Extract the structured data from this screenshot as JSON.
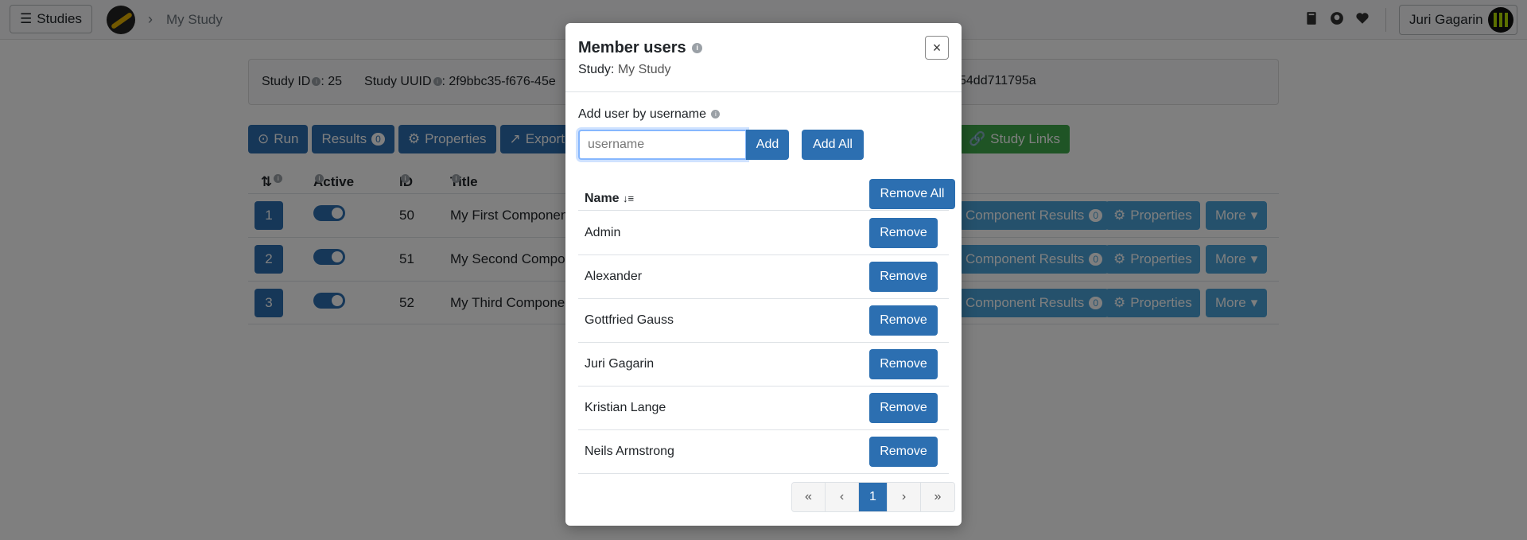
{
  "navbar": {
    "studies_label": "Studies",
    "breadcrumb": "My Study",
    "user_label": "Juri Gagarin"
  },
  "study_info": {
    "id_label": "Study ID",
    "id_value": ":  25",
    "uuid_label": "Study UUID",
    "uuid_value_visible": ":  2f9bbc35-f676-45e",
    "uuid_tail": "54dd711795a"
  },
  "toolbar": {
    "run": "Run",
    "results": "Results",
    "results_count": "0",
    "properties": "Properties",
    "export": "Export",
    "study_links": "Study Links"
  },
  "components_table": {
    "headers": {
      "position": "",
      "active": "Active",
      "id": "ID",
      "title": "Title"
    },
    "rows": [
      {
        "pos": "1",
        "id": "50",
        "title": "My First Component",
        "results": "Component Results",
        "count": "0",
        "props": "Properties",
        "more": "More"
      },
      {
        "pos": "2",
        "id": "51",
        "title": "My Second Compone",
        "results": "Component Results",
        "count": "0",
        "props": "Properties",
        "more": "More"
      },
      {
        "pos": "3",
        "id": "52",
        "title": "My Third Componen",
        "results": "Component Results",
        "count": "0",
        "props": "Properties",
        "more": "More"
      }
    ]
  },
  "modal": {
    "title": "Member users",
    "subtitle_label": "Study:",
    "subtitle_value": "My Study",
    "close_symbol": "×",
    "add_label": "Add user by username",
    "input_placeholder": "username",
    "input_value": "",
    "add_button": "Add",
    "add_all_button": "Add All",
    "name_header": "Name",
    "remove_all_button": "Remove All",
    "remove_button": "Remove",
    "users": [
      "Admin",
      "Alexander",
      "Gottfried Gauss",
      "Juri Gagarin",
      "Kristian Lange",
      "Neils Armstrong"
    ],
    "pagination": {
      "first": "«",
      "prev": "‹",
      "current": "1",
      "next": "›",
      "last": "»"
    }
  },
  "colors": {
    "primary": "#2c6fb1",
    "info": "#4aa3d8",
    "success": "#3ea84a"
  }
}
